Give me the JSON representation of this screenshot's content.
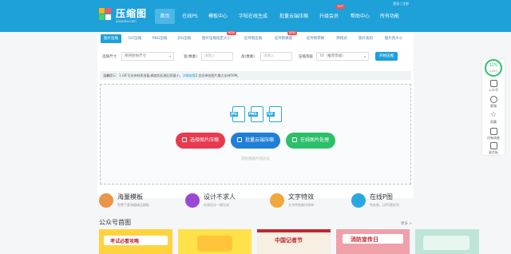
{
  "header": {
    "logo_text": "压缩图",
    "logo_sub": "yasuotu.com",
    "login_text": "登录 | 注册",
    "nav": [
      {
        "label": "首页",
        "hot": false
      },
      {
        "label": "在线PS",
        "hot": false
      },
      {
        "label": "模板中心",
        "hot": false
      },
      {
        "label": "字帖在线生成",
        "hot": false
      },
      {
        "label": "批量云端压缩",
        "hot": false
      },
      {
        "label": "升级会员",
        "hot": true,
        "hot_label": "HOT"
      },
      {
        "label": "帮助中心",
        "hot": false
      },
      {
        "label": "所有功能",
        "hot": false
      }
    ]
  },
  "tools": {
    "tabs": [
      {
        "label": "图片压缩",
        "hot": false
      },
      {
        "label": "GIF压缩",
        "hot": false
      },
      {
        "label": "PNG压缩",
        "hot": false
      },
      {
        "label": "JPG压缩",
        "hot": false
      },
      {
        "label": "图片压缩指定大小",
        "hot": true,
        "hot_label": "NEW"
      },
      {
        "label": "证件照压缩",
        "hot": false
      },
      {
        "label": "证件照换底",
        "hot": true,
        "hot_label": "NEW"
      },
      {
        "label": "证件照转换",
        "hot": false
      },
      {
        "label": "转格式",
        "hot": false
      },
      {
        "label": "图片裁剪",
        "hot": false
      },
      {
        "label": "图片改大小",
        "hot": false
      }
    ]
  },
  "options": {
    "size_label": "选择尺寸",
    "size_value": "保持原始尺寸",
    "width_label": "宽(像素)",
    "width_placeholder": "请输入",
    "height_label": "高(像素)",
    "height_placeholder": "请输入",
    "quality_label": "压缩等级",
    "quality_value": "70（推荐等级）",
    "start_button": "开始压缩"
  },
  "tip": {
    "lead": "温馨提示：",
    "text_a": "1.GIF可支持材质批量,精度如压缩后质量小。",
    "link": "详情查看",
    "text_b": "2.会员单张图片最大支持50M。"
  },
  "upload": {
    "file_types": [
      "JPG",
      "PNG",
      "GIF"
    ],
    "buttons": [
      {
        "label": "选择图片压缩",
        "color": "#e83a4f"
      },
      {
        "label": "批量云端压缩",
        "color": "#1f7fd6"
      },
      {
        "label": "在线图片处理",
        "color": "#2bbf6a"
      }
    ],
    "hint": "或拖拽图片到此处"
  },
  "features": [
    {
      "title": "海量模板",
      "desc": "免费下载海量精品模板",
      "color": "#e9954a"
    },
    {
      "title": "设计不求人",
      "desc": "在线设计一键生成",
      "color": "#9a4ad1"
    },
    {
      "title": "文字特效",
      "desc": "文字特效制作简单",
      "color": "#f0a83c"
    },
    {
      "title": "在线P图",
      "desc": "免安装，比PS更好用",
      "color": "#2ba6e0"
    }
  ],
  "section": {
    "title": "公众号首图",
    "more": "更多 >"
  },
  "thumbnails": [
    {
      "text": "考试必看攻略",
      "bg": "#ffd33d",
      "fg": "#c2262e"
    },
    {
      "text": "",
      "bg": "#ffe24a",
      "fg": "#c2262e"
    },
    {
      "text": "中国记者节",
      "bg": "#f6efe2",
      "fg": "#c2262e"
    },
    {
      "text": "消防宣传日",
      "bg": "#f0a0a8",
      "fg": "#c2262e"
    },
    {
      "text": "",
      "bg": "#bde5d8",
      "fg": "#2e6f5d"
    }
  ],
  "side": {
    "score": "12%",
    "score_sub": "4.8K/s",
    "items": [
      {
        "label": "公众号",
        "icon": "qr-icon"
      },
      {
        "label": "客服",
        "icon": "headset-icon"
      },
      {
        "label": "收藏",
        "icon": "star-icon"
      },
      {
        "label": "问卷调查",
        "icon": "survey-icon"
      },
      {
        "label": "留言板",
        "icon": "message-icon"
      }
    ]
  }
}
